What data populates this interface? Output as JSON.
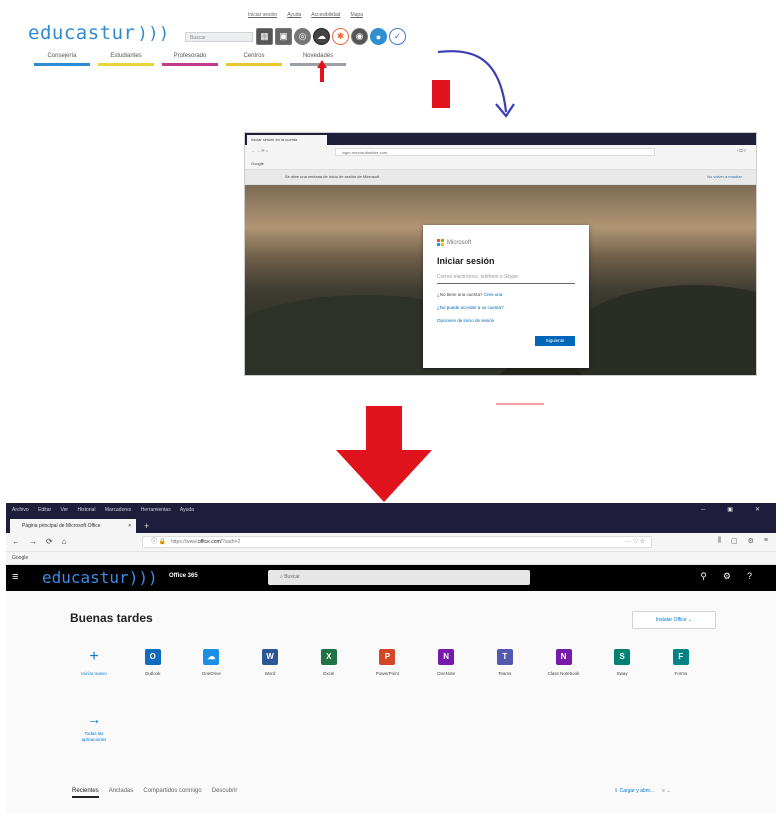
{
  "portal": {
    "top_links": [
      "Iniciar sesión",
      "Ayuda",
      "Accesibilidad",
      "Mapa"
    ],
    "logo": "educastur",
    "search_placeholder": "Buscar",
    "tabs": [
      "Consejería",
      "Estudiantes",
      "Profesorado",
      "Centros",
      "Novedades"
    ],
    "tab_colors": [
      "#2e8bd0",
      "#e8d43c",
      "#c23b8a",
      "#e8c632",
      "#9aa0a6"
    ]
  },
  "signin_screenshot": {
    "tab_title": "Iniciar sesión en la cuenta",
    "url": "login.microsoftonline.com",
    "bookmark": "Google",
    "notice": "Se abre una ventana de inicio de sesión de Microsoft",
    "notice_action": "No volver a mostrar",
    "brand": "Microsoft",
    "heading": "Iniciar sesión",
    "email_placeholder": "Correo electrónico, teléfono o Skype",
    "no_account_prefix": "¿No tiene una cuenta?",
    "no_account_link": "Cree una",
    "cannot_access": "¿No puede acceder a su cuenta?",
    "sign_in_options": "Opciones de inicio de sesión",
    "next_button": "Siguiente"
  },
  "office_browser": {
    "menu": [
      "Archivo",
      "Editar",
      "Ver",
      "Historial",
      "Marcadores",
      "Herramientas",
      "Ayuda"
    ],
    "tab_title": "Página principal de Microsoft Office",
    "url_prefix": "https://www.",
    "url_host": "office.com",
    "url_suffix": "/?auth=2",
    "bookmark": "Google",
    "logo": "educastur",
    "product": "Office 365",
    "search_placeholder": "Buscar",
    "greeting": "Buenas tardes",
    "install_button": "Instalar Office ⌄",
    "apps": [
      {
        "name": "Iniciar nuevo",
        "icon": "plus-icon",
        "glyph": "+",
        "color": ""
      },
      {
        "name": "Outlook",
        "icon": "outlook-icon",
        "glyph": "O",
        "color": "#0f6cbd"
      },
      {
        "name": "OneDrive",
        "icon": "onedrive-icon",
        "glyph": "☁",
        "color": "#1b8fe6"
      },
      {
        "name": "Word",
        "icon": "word-icon",
        "glyph": "W",
        "color": "#2b5797"
      },
      {
        "name": "Excel",
        "icon": "excel-icon",
        "glyph": "X",
        "color": "#217346"
      },
      {
        "name": "PowerPoint",
        "icon": "powerpoint-icon",
        "glyph": "P",
        "color": "#d24726"
      },
      {
        "name": "OneNote",
        "icon": "onenote-icon",
        "glyph": "N",
        "color": "#7719aa"
      },
      {
        "name": "Teams",
        "icon": "teams-icon",
        "glyph": "T",
        "color": "#5558af"
      },
      {
        "name": "Class Notebook",
        "icon": "class-notebook-icon",
        "glyph": "N",
        "color": "#7719aa"
      },
      {
        "name": "Sway",
        "icon": "sway-icon",
        "glyph": "S",
        "color": "#008272"
      },
      {
        "name": "Forms",
        "icon": "forms-icon",
        "glyph": "F",
        "color": "#038387"
      }
    ],
    "all_apps": "Todas las aplicaciones",
    "filters": [
      "Recientes",
      "Ancladas",
      "Compartidos conmigo",
      "Descubrir"
    ],
    "upload": "Cargar y abrir...",
    "upload_more": "≡ ⌄"
  }
}
